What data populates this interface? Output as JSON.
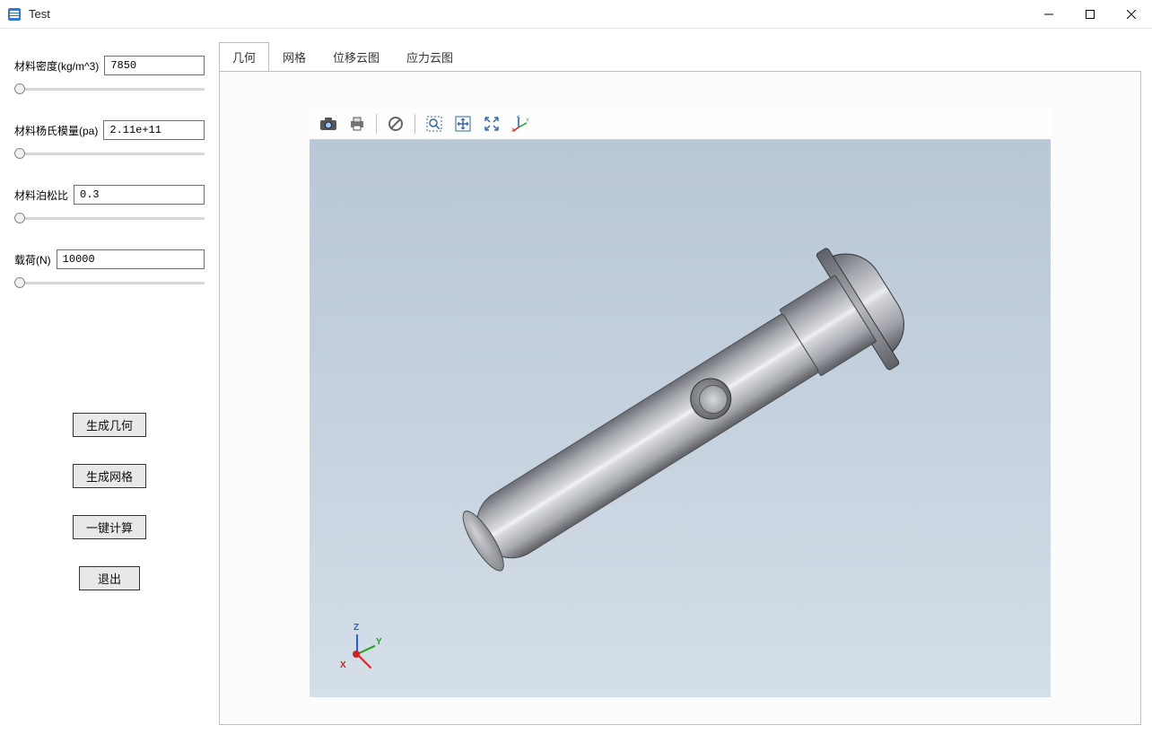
{
  "window": {
    "title": "Test"
  },
  "sidebar": {
    "params": [
      {
        "label": "材料密度(kg/m^3)",
        "value": "7850"
      },
      {
        "label": "材料杨氏模量(pa)",
        "value": "2.11e+11"
      },
      {
        "label": "材料泊松比",
        "value": "0.3"
      },
      {
        "label": "载荷(N)",
        "value": "10000"
      }
    ],
    "buttons": [
      {
        "label": "生成几何"
      },
      {
        "label": "生成网格"
      },
      {
        "label": "一键计算"
      },
      {
        "label": "退出"
      }
    ]
  },
  "tabs": [
    {
      "label": "几何",
      "active": true
    },
    {
      "label": "网格",
      "active": false
    },
    {
      "label": "位移云图",
      "active": false
    },
    {
      "label": "应力云图",
      "active": false
    }
  ],
  "viewer_toolbar": [
    {
      "name": "camera-icon"
    },
    {
      "name": "print-icon"
    },
    {
      "sep": true
    },
    {
      "name": "cancel-icon"
    },
    {
      "sep": true
    },
    {
      "name": "zoom-area-icon"
    },
    {
      "name": "pan-icon"
    },
    {
      "name": "fit-icon"
    },
    {
      "name": "axes-icon"
    }
  ],
  "axes": {
    "z": "Z",
    "y": "Y",
    "x": "X"
  }
}
